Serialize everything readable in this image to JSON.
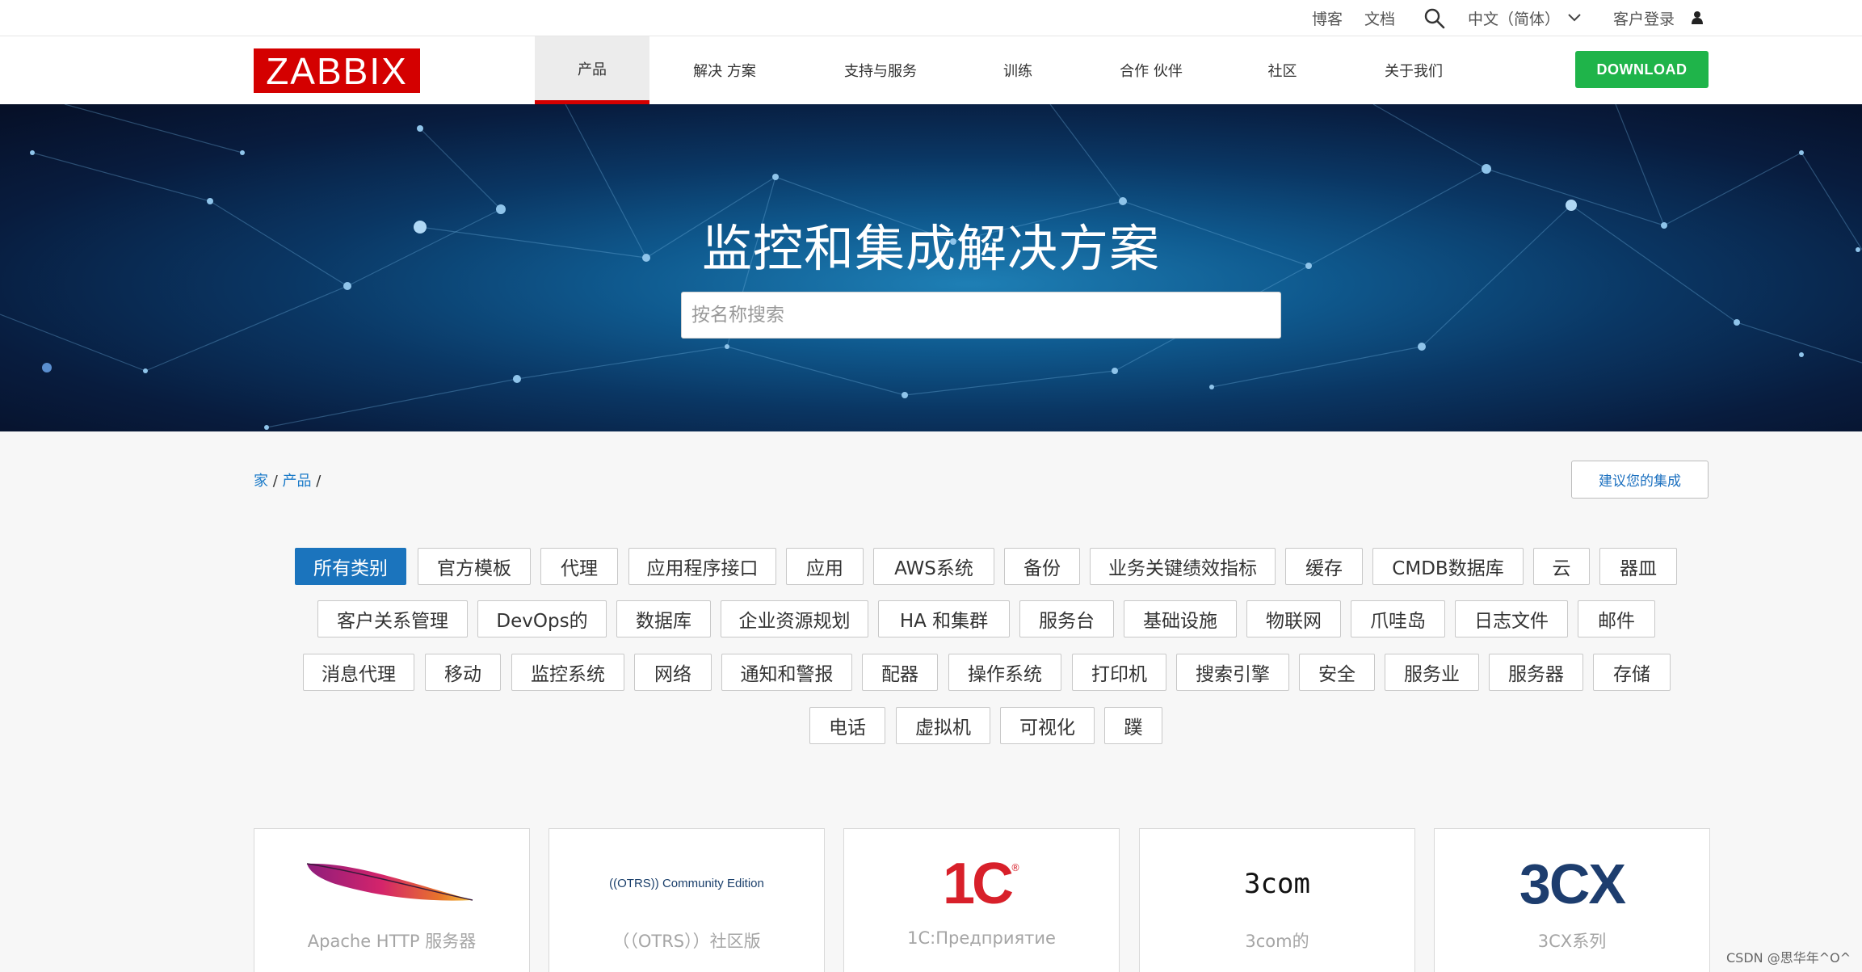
{
  "topbar": {
    "blog": "博客",
    "docs": "文档",
    "language": "中文（简体）",
    "customer_login": "客户登录"
  },
  "nav": {
    "logo_text": "ZABBIX",
    "items": [
      "产品",
      "解决 方案",
      "支持与服务",
      "训练",
      "合作 伙伴",
      "社区",
      "关于我们"
    ],
    "download": "DOWNLOAD"
  },
  "hero": {
    "title": "监控和集成解决方案",
    "search_placeholder": "按名称搜索"
  },
  "breadcrumb": {
    "home": "家",
    "sep": " / ",
    "products": "产品",
    "tail": " /"
  },
  "suggest_button": "建议您的集成",
  "tags": [
    "所有类别",
    "官方模板",
    "代理",
    "应用程序接口",
    "应用",
    "AWS系统",
    "备份",
    "业务关键绩效指标",
    "缓存",
    "CMDB数据库",
    "云",
    "器皿",
    "客户关系管理",
    "DevOps的",
    "数据库",
    "企业资源规划",
    "HA 和集群",
    "服务台",
    "基础设施",
    "物联网",
    "爪哇岛",
    "日志文件",
    "邮件",
    "消息代理",
    "移动",
    "监控系统",
    "网络",
    "通知和警报",
    "配器",
    "操作系统",
    "打印机",
    "搜索引擎",
    "安全",
    "服务业",
    "服务器",
    "存储",
    "电话",
    "虚拟机",
    "可视化",
    "蹼"
  ],
  "cards": [
    {
      "caption": "Apache HTTP 服务器",
      "icon": "apache-feather-icon"
    },
    {
      "caption": "（（OTRS））社区版",
      "logo_text": "((OTRS)) Community Edition"
    },
    {
      "caption": "1C:Предприятие",
      "logo_text": "1С",
      "logo_mark": "®"
    },
    {
      "caption": "3com的",
      "logo_text": "3com"
    },
    {
      "caption": "3CX系列",
      "logo_text": "3CX"
    }
  ],
  "watermark": "CSDN @思华年^O^",
  "colors": {
    "brand_red": "#d40000",
    "download_green": "#1fb44a",
    "active_blue": "#1b74bd",
    "link_blue": "#1a7ac8"
  }
}
